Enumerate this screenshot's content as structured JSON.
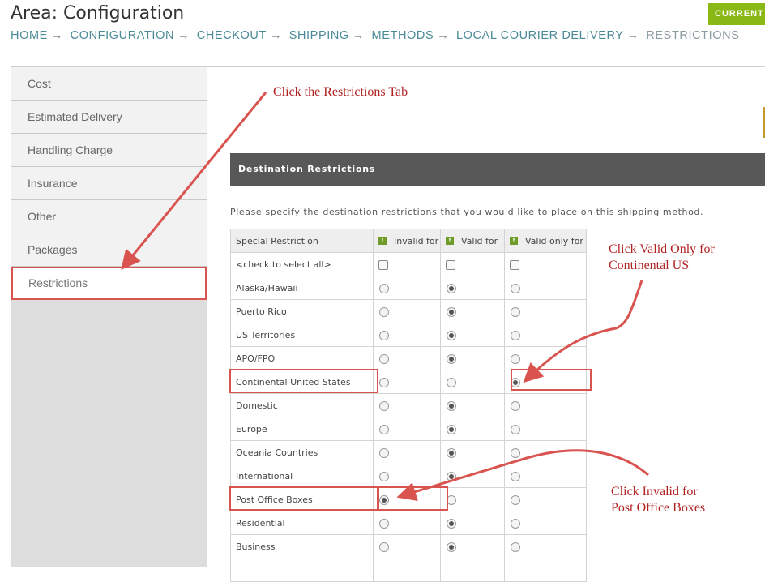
{
  "page": {
    "title": "Area: Configuration",
    "current_button": "CURRENT S"
  },
  "breadcrumb": {
    "items": [
      "HOME",
      "CONFIGURATION",
      "CHECKOUT",
      "SHIPPING",
      "METHODS",
      "LOCAL COURIER DELIVERY"
    ],
    "current": "RESTRICTIONS",
    "separator": "→"
  },
  "sidebar": {
    "items": [
      "Cost",
      "Estimated Delivery",
      "Handling Charge",
      "Insurance",
      "Other",
      "Packages",
      "Restrictions"
    ],
    "active": "Restrictions"
  },
  "section": {
    "title": "Destination Restrictions",
    "instructions": "Please specify the destination restrictions that you would like to place on this shipping method."
  },
  "table": {
    "headers": [
      "Special Restriction",
      "Invalid for",
      "Valid for",
      "Valid only for"
    ],
    "select_all_label": "<check to select all>",
    "rows": [
      {
        "label": "Alaska/Hawaii",
        "selected": "valid"
      },
      {
        "label": "Puerto Rico",
        "selected": "valid"
      },
      {
        "label": "US Territories",
        "selected": "valid"
      },
      {
        "label": "APO/FPO",
        "selected": "valid"
      },
      {
        "label": "Continental United States",
        "selected": "valid_only"
      },
      {
        "label": "Domestic",
        "selected": "valid"
      },
      {
        "label": "Europe",
        "selected": "valid"
      },
      {
        "label": "Oceania Countries",
        "selected": "valid"
      },
      {
        "label": "International",
        "selected": "valid"
      },
      {
        "label": "Post Office Boxes",
        "selected": "invalid"
      },
      {
        "label": "Residential",
        "selected": "valid"
      },
      {
        "label": "Business",
        "selected": "valid"
      }
    ]
  },
  "annotations": {
    "restrictions_tab": "Click the Restrictions Tab",
    "continental_line1": "Click Valid Only for",
    "continental_line2": "Continental US",
    "po_line1": "Click Invalid for",
    "po_line2": "Post Office Boxes"
  },
  "colors": {
    "annotation_red": "#d9534f",
    "annotation_text": "#b22222",
    "header_bar": "#585858",
    "accent_green": "#8ab814",
    "breadcrumb_link": "#4a8a96"
  }
}
